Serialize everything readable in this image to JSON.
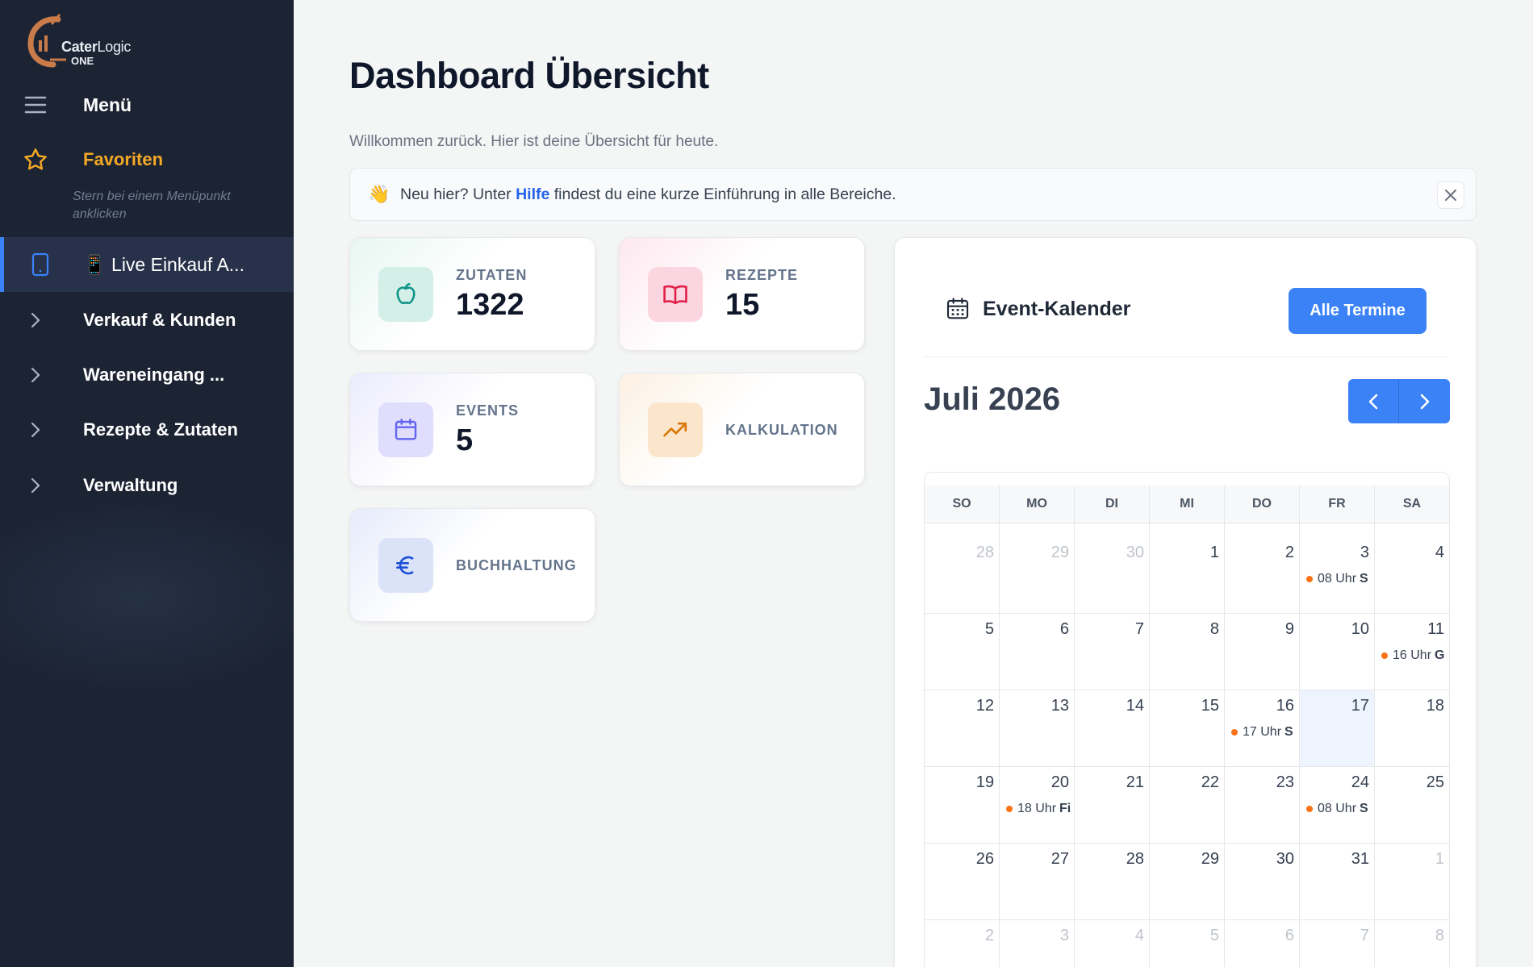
{
  "logo": {
    "word_bold": "Cater",
    "word_regular": "Logic",
    "word2": "ONE"
  },
  "sidebar": {
    "menu_label": "Menü",
    "favorites_label": "Favoriten",
    "favorites_hint": "Stern bei einem Menüpunkt anklicken",
    "items": [
      {
        "label": "📱 Live Einkauf A...",
        "active": true
      },
      {
        "label": "Verkauf & Kunden"
      },
      {
        "label": "Wareneingang ..."
      },
      {
        "label": "Rezepte & Zutaten"
      },
      {
        "label": "Verwaltung"
      }
    ]
  },
  "main": {
    "title": "Dashboard Übersicht",
    "subtitle": "Willkommen zurück. Hier ist deine Übersicht für heute.",
    "notice": {
      "before": "Neu hier? Unter ",
      "link": "Hilfe",
      "after": " findest du eine kurze Einführung in alle Bereiche."
    }
  },
  "cards": [
    {
      "label": "ZUTATEN",
      "value": "1322",
      "icon": "apple-icon",
      "color": "#14b8a6"
    },
    {
      "label": "REZEPTE",
      "value": "15",
      "icon": "book-icon",
      "color": "#e11d48"
    },
    {
      "label": "EVENTS",
      "value": "5",
      "icon": "calendar-icon",
      "color": "#6366f1"
    },
    {
      "label": "KALKULATION",
      "value": "",
      "icon": "trending-up-icon",
      "color": "#d97706"
    },
    {
      "label": "BUCHHALTUNG",
      "value": "",
      "icon": "euro-icon",
      "color": "#1d4ed8"
    }
  ],
  "calendar": {
    "title": "Event-Kalender",
    "all_button": "Alle Termine",
    "month_label": "Juli 2026",
    "weekdays": [
      "SO",
      "MO",
      "DI",
      "MI",
      "DO",
      "FR",
      "SA"
    ],
    "today": "17",
    "weeks": [
      [
        {
          "d": "28",
          "m": true
        },
        {
          "d": "29",
          "m": true
        },
        {
          "d": "30",
          "m": true
        },
        {
          "d": "1"
        },
        {
          "d": "2"
        },
        {
          "d": "3",
          "ev": "08 Uhr",
          "evb": "S"
        },
        {
          "d": "4"
        }
      ],
      [
        {
          "d": "5"
        },
        {
          "d": "6"
        },
        {
          "d": "7"
        },
        {
          "d": "8"
        },
        {
          "d": "9"
        },
        {
          "d": "10"
        },
        {
          "d": "11",
          "ev": "16 Uhr",
          "evb": "G"
        }
      ],
      [
        {
          "d": "12"
        },
        {
          "d": "13"
        },
        {
          "d": "14"
        },
        {
          "d": "15"
        },
        {
          "d": "16",
          "ev": "17 Uhr",
          "evb": "S"
        },
        {
          "d": "17",
          "today": true
        },
        {
          "d": "18"
        }
      ],
      [
        {
          "d": "19"
        },
        {
          "d": "20",
          "ev": "18 Uhr",
          "evb": "Fi"
        },
        {
          "d": "21"
        },
        {
          "d": "22"
        },
        {
          "d": "23"
        },
        {
          "d": "24",
          "ev": "08 Uhr",
          "evb": "S"
        },
        {
          "d": "25"
        }
      ],
      [
        {
          "d": "26"
        },
        {
          "d": "27"
        },
        {
          "d": "28"
        },
        {
          "d": "29"
        },
        {
          "d": "30"
        },
        {
          "d": "31"
        },
        {
          "d": "1",
          "m": true
        }
      ],
      [
        {
          "d": "2",
          "m": true
        },
        {
          "d": "3",
          "m": true
        },
        {
          "d": "4",
          "m": true
        },
        {
          "d": "5",
          "m": true
        },
        {
          "d": "6",
          "m": true
        },
        {
          "d": "7",
          "m": true
        },
        {
          "d": "8",
          "m": true
        }
      ]
    ],
    "event_color": "#f97316",
    "accent": "#3b82f6"
  }
}
